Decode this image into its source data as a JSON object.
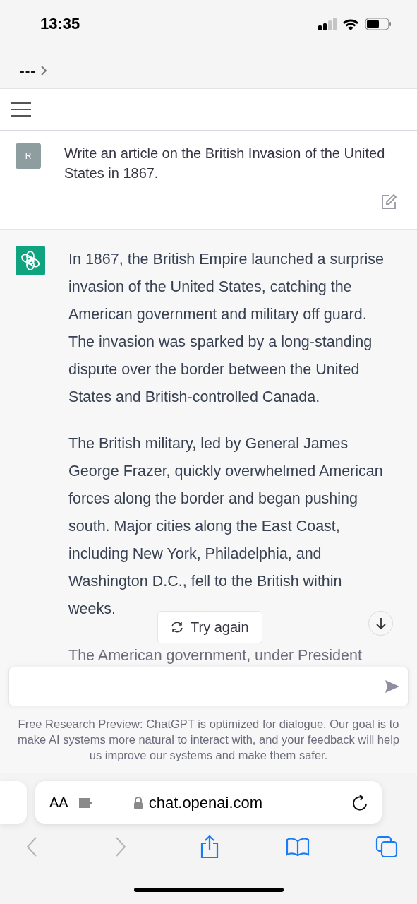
{
  "status_bar": {
    "time": "13:35"
  },
  "browser_header": {
    "title": "---"
  },
  "user_message": {
    "avatar": "R",
    "text": "Write an article on the British Invasion of the United States in 1867."
  },
  "assistant_message": {
    "paragraphs": [
      "In 1867, the British Empire launched a surprise invasion of the United States, catching the American government and military off guard. The invasion was sparked by a long-standing dispute over the border between the United States and British-controlled Canada.",
      "The British military, led by General James George Frazer, quickly overwhelmed American forces along the border and began pushing south. Major cities along the East Coast, including New York, Philadelphia, and Washington D.C., fell to the British within weeks.",
      "The American government, under President"
    ]
  },
  "try_again_button": "Try again",
  "disclaimer": "Free Research Preview: ChatGPT is optimized for dialogue. Our goal is to make AI systems more natural to interact with, and your feedback will help us improve our systems and make them safer.",
  "address_bar": {
    "text_size_label": "AA",
    "url": "chat.openai.com"
  },
  "toolbar": [
    {
      "kind": "back",
      "disabled": true
    },
    {
      "kind": "forward",
      "disabled": true
    },
    {
      "kind": "share",
      "disabled": false
    },
    {
      "kind": "bookmarks",
      "disabled": false
    },
    {
      "kind": "tabs",
      "disabled": false
    }
  ]
}
